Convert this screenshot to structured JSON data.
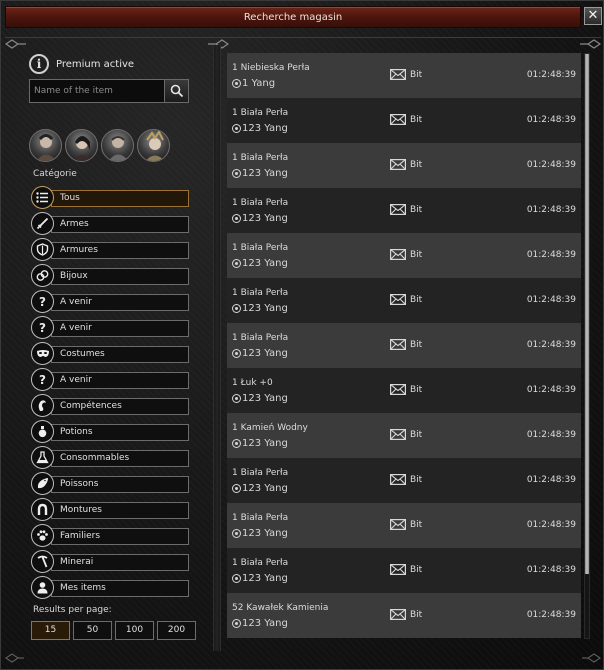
{
  "window": {
    "title": "Recherche magasin",
    "close_glyph": "✕"
  },
  "premium": {
    "icon": "info-icon",
    "text": "Premium active"
  },
  "search": {
    "placeholder": "Name of the item",
    "icon": "search-icon"
  },
  "characters": [
    {
      "name": "warrior-portrait"
    },
    {
      "name": "assassin-portrait"
    },
    {
      "name": "sura-portrait"
    },
    {
      "name": "shaman-portrait"
    }
  ],
  "category_title": "Catégorie",
  "categories": [
    {
      "label": "Tous",
      "icon": "list-icon",
      "active": true
    },
    {
      "label": "Armes",
      "icon": "sword-icon",
      "active": false
    },
    {
      "label": "Armures",
      "icon": "shield-icon",
      "active": false
    },
    {
      "label": "Bijoux",
      "icon": "jewelry-icon",
      "active": false
    },
    {
      "label": "A venir",
      "icon": "question-icon",
      "active": false
    },
    {
      "label": "A venir",
      "icon": "question-icon",
      "active": false
    },
    {
      "label": "Costumes",
      "icon": "mask-icon",
      "active": false
    },
    {
      "label": "A venir",
      "icon": "question-icon",
      "active": false
    },
    {
      "label": "Compétences",
      "icon": "skill-icon",
      "active": false
    },
    {
      "label": "Potions",
      "icon": "potion-icon",
      "active": false
    },
    {
      "label": "Consommables",
      "icon": "flask-icon",
      "active": false
    },
    {
      "label": "Poissons",
      "icon": "fish-icon",
      "active": false
    },
    {
      "label": "Montures",
      "icon": "horseshoe-icon",
      "active": false
    },
    {
      "label": "Familiers",
      "icon": "paw-icon",
      "active": false
    },
    {
      "label": "Minerai",
      "icon": "pickaxe-icon",
      "active": false
    },
    {
      "label": "Mes items",
      "icon": "user-icon",
      "active": false
    }
  ],
  "results_per_page": {
    "label": "Results per page:",
    "options": [
      "15",
      "50",
      "100",
      "200"
    ],
    "selected": "15"
  },
  "results": [
    {
      "name": "1 Niebieska Perła",
      "price": "1 Yang",
      "seller": "Bit",
      "time": "01:2:48:39"
    },
    {
      "name": "1 Biała Perła",
      "price": "123 Yang",
      "seller": "Bit",
      "time": "01:2:48:39"
    },
    {
      "name": "1 Biała Perła",
      "price": "123 Yang",
      "seller": "Bit",
      "time": "01:2:48:39"
    },
    {
      "name": "1 Biała Perła",
      "price": "123 Yang",
      "seller": "Bit",
      "time": "01:2:48:39"
    },
    {
      "name": "1 Biała Perła",
      "price": "123 Yang",
      "seller": "Bit",
      "time": "01:2:48:39"
    },
    {
      "name": "1 Biała Perła",
      "price": "123 Yang",
      "seller": "Bit",
      "time": "01:2:48:39"
    },
    {
      "name": "1 Biała Perła",
      "price": "123 Yang",
      "seller": "Bit",
      "time": "01:2:48:39"
    },
    {
      "name": "1 Łuk +0",
      "price": "123 Yang",
      "seller": "Bit",
      "time": "01:2:48:39"
    },
    {
      "name": "1 Kamień Wodny",
      "price": "123 Yang",
      "seller": "Bit",
      "time": "01:2:48:39"
    },
    {
      "name": "1 Biała Perła",
      "price": "123 Yang",
      "seller": "Bit",
      "time": "01:2:48:39"
    },
    {
      "name": "1 Biała Perła",
      "price": "123 Yang",
      "seller": "Bit",
      "time": "01:2:48:39"
    },
    {
      "name": "1 Biała Perła",
      "price": "123 Yang",
      "seller": "Bit",
      "time": "01:2:48:39"
    },
    {
      "name": "52 Kawałek Kamienia",
      "price": "123 Yang",
      "seller": "Bit",
      "time": "01:2:48:39"
    }
  ],
  "row_icon": "mail-icon"
}
